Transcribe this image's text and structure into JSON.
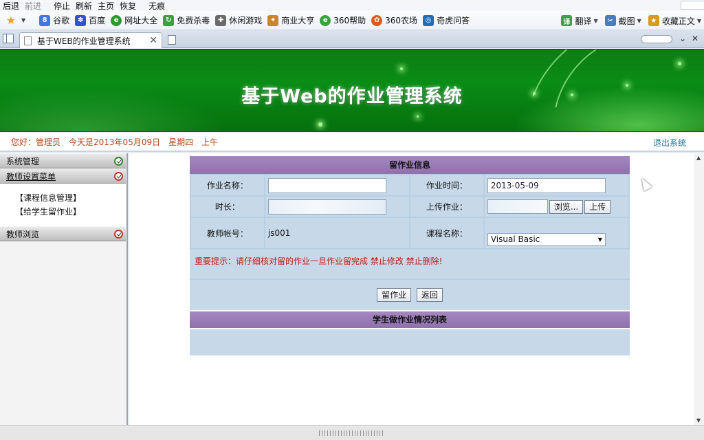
{
  "browser": {
    "menu": [
      "后退",
      "前进",
      "停止",
      "刷新",
      "主页",
      "恢复",
      "无痕"
    ],
    "favorites": [
      {
        "label": "谷歌",
        "icon": "google-icon",
        "color": "#3b78e7"
      },
      {
        "label": "百度",
        "icon": "baidu-icon",
        "color": "#2a55d6"
      },
      {
        "label": "网址大全",
        "icon": "sites-icon",
        "color": "#2c9a2c"
      },
      {
        "label": "免费杀毒",
        "icon": "antivirus-icon",
        "color": "#3aa33a"
      },
      {
        "label": "休闲游戏",
        "icon": "gamepad-icon",
        "color": "#555555"
      },
      {
        "label": "商业大亨",
        "icon": "business-icon",
        "color": "#c9862e"
      },
      {
        "label": "360帮助",
        "icon": "help-icon",
        "color": "#37a33f"
      },
      {
        "label": "360农场",
        "icon": "farm-icon",
        "color": "#e0561d"
      },
      {
        "label": "奇虎问答",
        "icon": "qa-icon",
        "color": "#1f6fb8"
      }
    ],
    "tools": [
      "翻译",
      "截图",
      "收藏正文"
    ],
    "tab_title": "基于WEB的作业管理系统"
  },
  "banner": {
    "title": "基于Web的作业管理系统"
  },
  "info": {
    "greeting": "您好：管理员",
    "date": "今天是2013年05月09日",
    "weekday": "星期四",
    "period": "上午",
    "logout": "退出系统"
  },
  "sidebar": {
    "sections": [
      {
        "label": "系统管理"
      },
      {
        "label": "教师设置菜单",
        "items": [
          "【课程信息管理】",
          "【给学生留作业】"
        ]
      },
      {
        "label": "教师浏览"
      }
    ]
  },
  "form": {
    "header": "留作业信息",
    "homework_name_label": "作业名称：",
    "homework_name_value": "",
    "homework_time_label": "作业时间：",
    "homework_time_value": "2013-05-09",
    "duration_label": "时长：",
    "duration_value": "",
    "upload_label": "上传作业：",
    "browse_button": "浏览...",
    "upload_button": "上传",
    "teacher_id_label": "教师帐号：",
    "teacher_id_value": "js001",
    "course_name_label": "课程名称：",
    "course_name_selected": "Visual Basic",
    "warning": "重要提示：请仔细核对留的作业一旦作业留完成 禁止修改 禁止删除!",
    "submit_button": "留作业",
    "back_button": "返回",
    "list_header": "学生做作业情况列表"
  }
}
